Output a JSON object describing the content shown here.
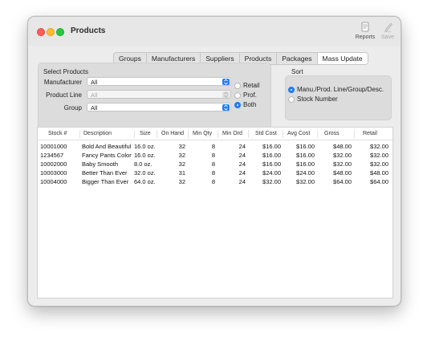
{
  "window": {
    "title": "Products"
  },
  "toolbar": {
    "reports_label": "Reports",
    "save_label": "Save"
  },
  "tabs": [
    "Groups",
    "Manufacturers",
    "Suppliers",
    "Products",
    "Packages",
    "Mass Update"
  ],
  "active_tab": "Mass Update",
  "select_products": {
    "label": "Select Products",
    "manufacturer": {
      "label": "Manufacturer",
      "value": "All"
    },
    "product_line": {
      "label": "Product Line",
      "value": "All"
    },
    "group": {
      "label": "Group",
      "value": "All"
    },
    "price_type": {
      "options": [
        "Retail",
        "Prof.",
        "Both"
      ],
      "selected": "Both"
    }
  },
  "sort": {
    "label": "Sort",
    "options": [
      "Manu./Prod. Line/Group/Desc.",
      "Stock Number"
    ],
    "selected": "Manu./Prod. Line/Group/Desc."
  },
  "table": {
    "columns": [
      "Stock #",
      "Description",
      "Size",
      "On Hand",
      "Min Qty",
      "Min Ord",
      "Std Cost",
      "Avg Cost",
      "Gross",
      "Retail"
    ],
    "rows": [
      [
        "10001000",
        "Bold And Beautiful",
        "16.0 oz.",
        "32",
        "8",
        "24",
        "$16.00",
        "$16.00",
        "$48.00",
        "$32.00"
      ],
      [
        "1234567",
        "Fancy Pants Color",
        "16.0 oz.",
        "32",
        "8",
        "24",
        "$16.00",
        "$16.00",
        "$32.00",
        "$32.00"
      ],
      [
        "10002000",
        "Baby Smooth",
        "8.0 oz.",
        "32",
        "8",
        "24",
        "$16.00",
        "$16.00",
        "$32.00",
        "$32.00"
      ],
      [
        "10003000",
        "Better Than Ever",
        "32.0 oz.",
        "31",
        "8",
        "24",
        "$24.00",
        "$24.00",
        "$48.00",
        "$48.00"
      ],
      [
        "10004000",
        "Bigger Than Ever",
        "64.0 oz.",
        "32",
        "8",
        "24",
        "$32.00",
        "$32.00",
        "$64.00",
        "$64.00"
      ]
    ]
  },
  "colors": {
    "accent": "#1f7cf5",
    "window_bg": "#ececec"
  }
}
